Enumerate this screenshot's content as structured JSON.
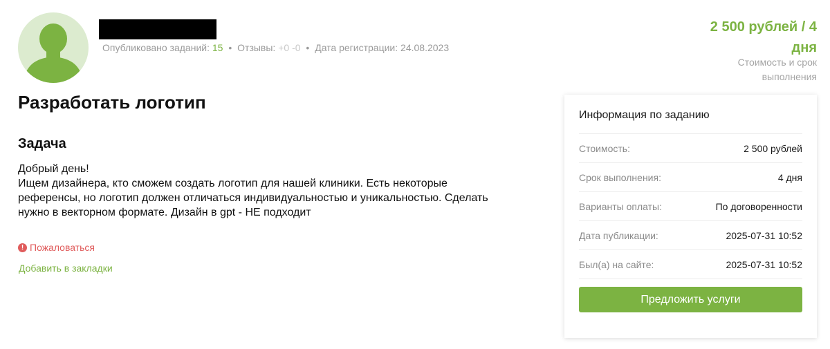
{
  "user": {
    "avatar_icon": "user-silhouette-icon",
    "name_redacted": true
  },
  "stats": {
    "published_label": "Опубликовано заданий:",
    "published_value": "15",
    "reviews_label": "Отзывы:",
    "reviews_positive": "+0",
    "reviews_negative": "-0",
    "registration_label": "Дата регистрации:",
    "registration_date": "24.08.2023",
    "separator": "•"
  },
  "price_header": {
    "line1": "2 500 рублей / 4",
    "line2": "дня",
    "caption_line1": "Стоимость и срок",
    "caption_line2": "выполнения"
  },
  "task": {
    "title": "Разработать логотип",
    "section_title": "Задача",
    "description_lines": [
      "Добрый день!",
      "Ищем дизайнера, кто сможем создать логотип для нашей клиники. Есть некоторые",
      "референсы, но логотип должен отличаться индивидуальностью и уникальностью. Сделать",
      "нужно в векторном формате. Дизайн в gpt - НЕ подходит"
    ]
  },
  "actions": {
    "complain_label": "Пожаловаться",
    "complain_icon": "exclamation-circle-icon",
    "bookmark_label": "Добавить в закладки"
  },
  "info_card": {
    "title": "Информация по заданию",
    "rows": [
      {
        "label": "Стоимость:",
        "value": "2 500 рублей"
      },
      {
        "label": "Срок выполнения:",
        "value": "4 дня"
      },
      {
        "label": "Варианты оплаты:",
        "value": "По договоренности"
      },
      {
        "label": "Дата публикации:",
        "value": "2025-07-31 10:52"
      },
      {
        "label": "Был(а) на сайте:",
        "value": "2025-07-31 10:52"
      }
    ],
    "button_label": "Предложить услуги"
  },
  "colors": {
    "accent_green": "#7cb342",
    "danger_red": "#e05c5c",
    "avatar_bg": "#dcebcf"
  }
}
